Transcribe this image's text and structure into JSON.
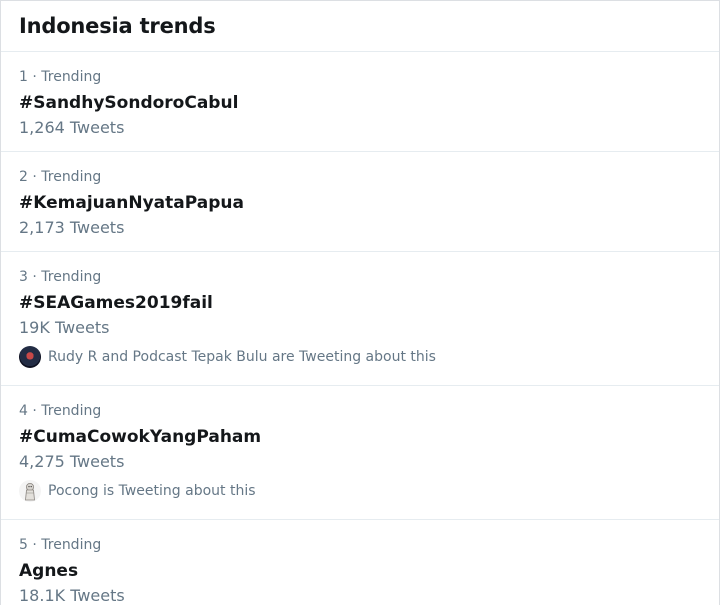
{
  "header": {
    "title": "Indonesia trends"
  },
  "trends": [
    {
      "meta": "1 · Trending",
      "name": "#SandhySondoroCabul",
      "count": "1,264 Tweets"
    },
    {
      "meta": "2 · Trending",
      "name": "#KemajuanNyataPapua",
      "count": "2,173 Tweets"
    },
    {
      "meta": "3 · Trending",
      "name": "#SEAGames2019fail",
      "count": "19K Tweets",
      "context": {
        "text": "Rudy R and Podcast Tepak Bulu are Tweeting about this",
        "icon": "user-avatar-icon"
      }
    },
    {
      "meta": "4 · Trending",
      "name": "#CumaCowokYangPaham",
      "count": "4,275 Tweets",
      "context": {
        "text": "Pocong is Tweeting about this",
        "icon": "pocong-avatar-icon"
      }
    },
    {
      "meta": "5 · Trending",
      "name": "Agnes",
      "count": "18.1K Tweets"
    }
  ],
  "colors": {
    "primary_text": "#14171a",
    "secondary_text": "#657786",
    "divider": "#e6ecf0"
  }
}
